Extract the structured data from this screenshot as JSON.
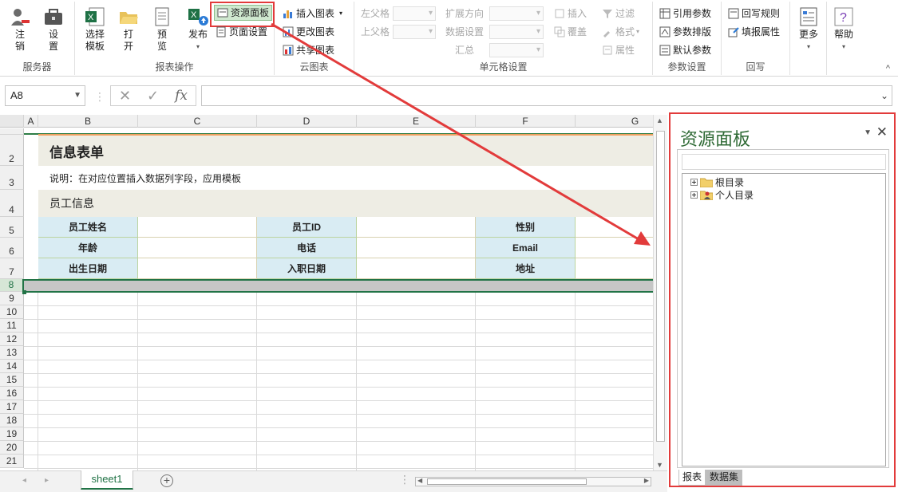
{
  "ribbon": {
    "server_group": {
      "label": "服务器",
      "logout": "注\n销",
      "settings": "设\n置"
    },
    "report_group": {
      "label": "报表操作",
      "select_template": "选择\n模板",
      "open": "打\n开",
      "preview": "预\n览",
      "publish": "发布"
    },
    "resource_panel_btn": "资源面板",
    "page_setup_btn": "页面设置",
    "cloud_group": {
      "label": "云图表",
      "insert_chart": "插入图表",
      "modify_chart": "更改图表",
      "share_chart": "共享图表"
    },
    "cell_group": {
      "label": "单元格设置",
      "left_parent": "左父格",
      "top_parent": "上父格",
      "expand_dir": "扩展方向",
      "data_setting": "数据设置",
      "summary": "汇总",
      "insert": "插入",
      "overlay": "覆盖",
      "filter": "过滤",
      "format": "格式",
      "property": "属性"
    },
    "param_group": {
      "label": "参数设置",
      "ref_param": "引用参数",
      "param_layout": "参数排版",
      "default_param": "默认参数"
    },
    "writeback_group": {
      "label": "回写",
      "wb_rule": "回写规则",
      "fill_prop": "填报属性"
    },
    "more": "更多",
    "help": "帮助"
  },
  "formula_bar": {
    "name_box": "A8",
    "fx": "fx",
    "value": ""
  },
  "sheet": {
    "columns": [
      "A",
      "B",
      "C",
      "D",
      "E",
      "F",
      "G"
    ],
    "rows": [
      "2",
      "3",
      "4",
      "5",
      "6",
      "7",
      "8",
      "9",
      "10",
      "11",
      "12",
      "13",
      "14",
      "15",
      "16",
      "17",
      "18",
      "19",
      "20",
      "21"
    ],
    "title": "信息表单",
    "description": "说明：在对应位置插入数据列字段，应用模板",
    "section": "员工信息",
    "labels": {
      "name": "员工姓名",
      "emp_id": "员工ID",
      "gender": "性别",
      "age": "年龄",
      "phone": "电话",
      "email": "Email",
      "birth": "出生日期",
      "hire_date": "入职日期",
      "address": "地址"
    },
    "sheet_tab": "sheet1"
  },
  "panel": {
    "title": "资源面板",
    "tree": [
      {
        "label": "根目录"
      },
      {
        "label": "个人目录"
      }
    ],
    "tabs": [
      {
        "label": "报表"
      },
      {
        "label": "数据集"
      }
    ]
  },
  "colors": {
    "accent_red": "#e23b3b",
    "panel_title": "#2f6a35",
    "label_bg": "#d9ecf3",
    "band_bg": "#eeede4"
  }
}
